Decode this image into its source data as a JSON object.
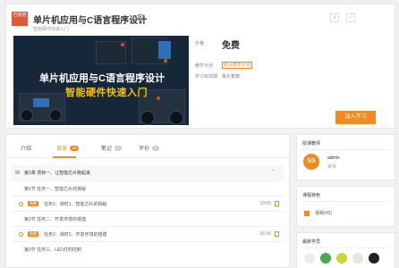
{
  "header": {
    "status_badge": "已完结",
    "title": "单片机应用与C语言程序设计",
    "subtitle": "智能硬件快速入门",
    "action_icons": [
      "share-icon",
      "heart-icon"
    ]
  },
  "cover": {
    "line1": "单片机应用与C语言程序设计",
    "line2": "智能硬件快速入门"
  },
  "info": {
    "price_label": "价格",
    "price": "免费",
    "plan_label": "教学计划",
    "plan_value": "默认教学计划",
    "period_label": "学习有效期",
    "period_value": "永久有效",
    "join_label": "加入学习"
  },
  "tabs": [
    {
      "label": "介绍",
      "badge": ""
    },
    {
      "label": "目录",
      "badge": "45"
    },
    {
      "label": "笔记",
      "badge": "0"
    },
    {
      "label": "评价",
      "badge": "0"
    }
  ],
  "lessons": [
    {
      "kind": "chapter",
      "text": "第1章 项目一、让智能芯片跑起来"
    },
    {
      "kind": "section",
      "text": "第1节 任务一、智能芯片的揭秘"
    },
    {
      "kind": "lesson",
      "free": "免费",
      "text": "任务1：课时1、智能芯片的揭秘",
      "duration": "10:05"
    },
    {
      "kind": "section",
      "text": "第2节 任务二、开发环境的搭建"
    },
    {
      "kind": "lesson",
      "free": "免费",
      "text": "任务2：课时2、开发环境的搭建",
      "duration": "06:30"
    },
    {
      "kind": "section",
      "text": "第3节 任务三、LED灯的控制"
    }
  ],
  "sidebar": {
    "teacher_heading": "授课教师",
    "teacher_name": "admin",
    "teacher_role": "讲师",
    "teacher_avatar_text": "SS",
    "features_heading": "课程特色",
    "feature_video": "视频(45)",
    "students_heading": "最新学员",
    "student_colors": [
      "#ececec",
      "#4aa84f",
      "#c8d63a",
      "#e8e6d8",
      "#222222"
    ]
  },
  "colors": {
    "accent": "#f08a24",
    "status_badge": "#e2573a",
    "cover_bg": "#16273a",
    "cover_highlight": "#f6c100"
  }
}
